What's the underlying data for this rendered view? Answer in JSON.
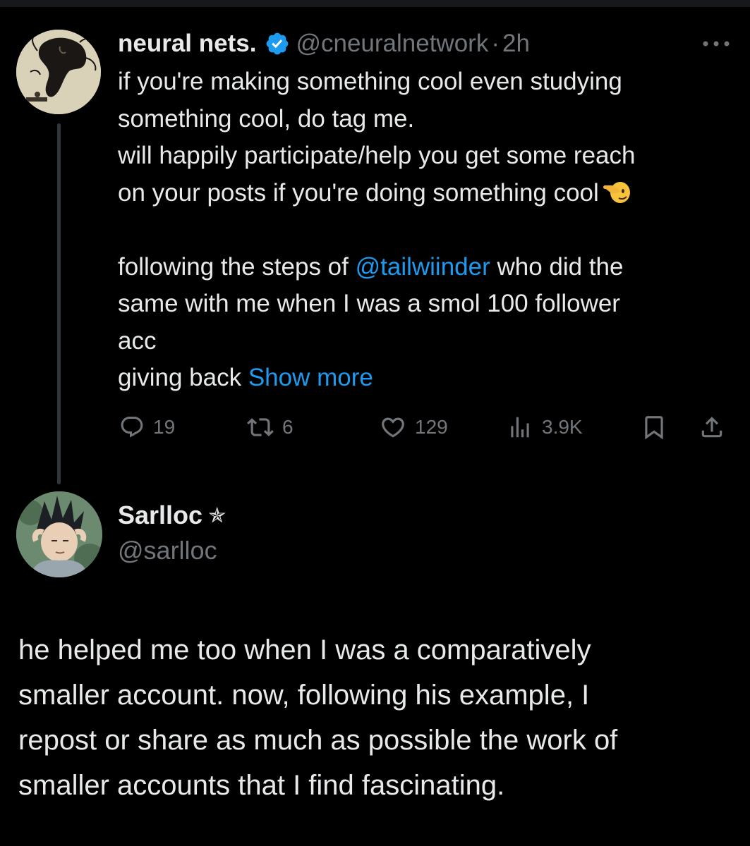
{
  "tweet": {
    "author_name": "neural nets.",
    "handle": "@cneuralnetwork",
    "separator": "·",
    "time": "2h",
    "verified": true,
    "more_icon": "more-horizontal-icon",
    "body": {
      "line1": "if you're making something cool even studying",
      "line2": "something cool, do tag me.",
      "line3": "will happily participate/help you get some reach",
      "line4": "on your posts if you're doing something cool",
      "line5_prefix": "following the steps of ",
      "line5_mention": "@tailwiinder",
      "line5_suffix": " who did the",
      "line6": "same with me when I was a smol 100 follower",
      "line7": "acc",
      "line8": "giving back ",
      "show_more": "Show more"
    },
    "emoji": "pointing-left-hand-emoji"
  },
  "actions": {
    "reply": {
      "icon": "reply-icon",
      "count": "19"
    },
    "repost": {
      "icon": "repost-icon",
      "count": "6"
    },
    "like": {
      "icon": "heart-icon",
      "count": "129"
    },
    "views": {
      "icon": "views-icon",
      "count": "3.9K"
    },
    "bookmark": {
      "icon": "bookmark-icon"
    },
    "share": {
      "icon": "share-icon"
    }
  },
  "reply": {
    "author_name": "Sarlloc",
    "star": "✯",
    "handle": "@sarlloc",
    "body": {
      "line1": "he helped me too when I was a comparatively",
      "line2": "smaller account. now, following his example, I",
      "line3": "repost or share as much as possible the work of",
      "line4": "smaller accounts that I find fascinating."
    }
  },
  "colors": {
    "background": "#000000",
    "text": "#e7e9ea",
    "muted": "#71767b",
    "accent": "#1d9bf0",
    "verified_badge": "#1d9bf0",
    "thread_line": "#333639"
  }
}
